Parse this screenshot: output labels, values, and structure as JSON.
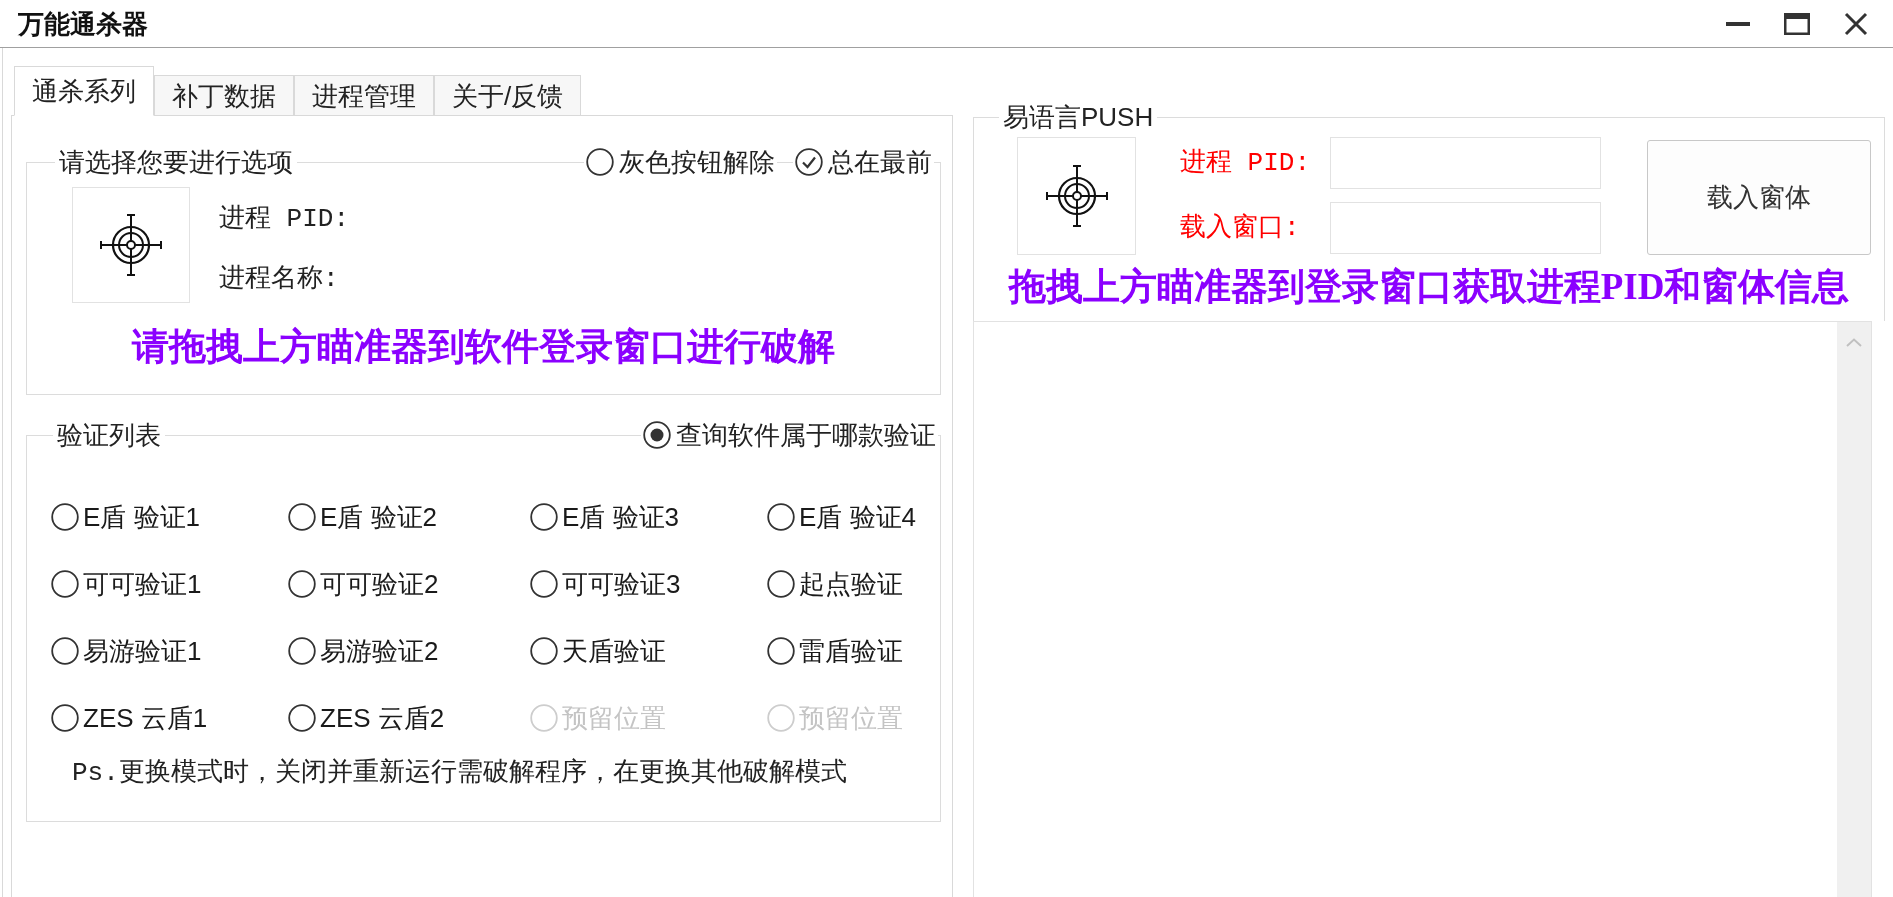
{
  "window": {
    "title": "万能通杀器"
  },
  "tabs": [
    {
      "label": "通杀系列",
      "selected": true
    },
    {
      "label": "补丁数据",
      "selected": false
    },
    {
      "label": "进程管理",
      "selected": false
    },
    {
      "label": "关于/反馈",
      "selected": false
    }
  ],
  "select_group": {
    "title": "请选择您要进行选项",
    "options": [
      {
        "label": "灰色按钮解除",
        "checked": false
      },
      {
        "label": "总在最前",
        "checked": true
      }
    ],
    "info_labels": [
      {
        "label": "进程 PID:"
      },
      {
        "label": "进程名称:"
      }
    ],
    "hint": "请拖拽上方瞄准器到软件登录窗口进行破解"
  },
  "verify_group": {
    "title": "验证列表",
    "query": {
      "label": "查询软件属于哪款验证",
      "selected": true
    },
    "options": [
      {
        "label": "E盾 验证1",
        "selected": false,
        "disabled": false
      },
      {
        "label": "E盾 验证2",
        "selected": false,
        "disabled": false
      },
      {
        "label": "E盾 验证3",
        "selected": false,
        "disabled": false
      },
      {
        "label": "E盾 验证4",
        "selected": false,
        "disabled": false
      },
      {
        "label": "可可验证1",
        "selected": false,
        "disabled": false
      },
      {
        "label": "可可验证2",
        "selected": false,
        "disabled": false
      },
      {
        "label": "可可验证3",
        "selected": false,
        "disabled": false
      },
      {
        "label": "起点验证",
        "selected": false,
        "disabled": false
      },
      {
        "label": "易游验证1",
        "selected": false,
        "disabled": false
      },
      {
        "label": "易游验证2",
        "selected": false,
        "disabled": false
      },
      {
        "label": "天盾验证",
        "selected": false,
        "disabled": false
      },
      {
        "label": "雷盾验证",
        "selected": false,
        "disabled": false
      },
      {
        "label": "ZES 云盾1",
        "selected": false,
        "disabled": false
      },
      {
        "label": "ZES 云盾2",
        "selected": false,
        "disabled": false
      },
      {
        "label": "预留位置",
        "selected": false,
        "disabled": true
      },
      {
        "label": "预留位置",
        "selected": false,
        "disabled": true
      }
    ],
    "note": "Ps.更换模式时，关闭并重新运行需破解程序，在更换其他破解模式"
  },
  "push_group": {
    "title": "易语言PUSH",
    "fields": [
      {
        "label": "进程 PID:"
      },
      {
        "label": "载入窗口:"
      }
    ],
    "button": "载入窗体",
    "hint": "拖拽上方瞄准器到登录窗口获取进程PID和窗体信息"
  }
}
